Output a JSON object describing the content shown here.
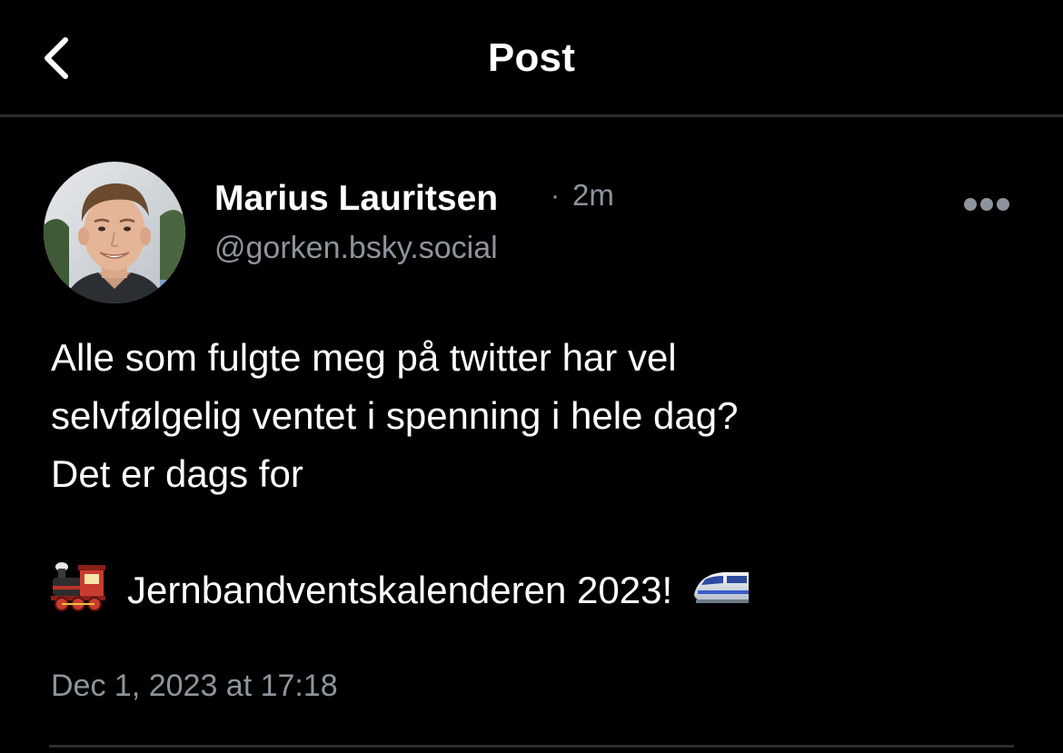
{
  "header": {
    "title": "Post",
    "back_icon": "chevron-left-icon"
  },
  "post": {
    "author_name": "Marius Lauritsen",
    "separator": "·",
    "age": "2m",
    "handle": "@gorken.bsky.social",
    "more_icon": "ellipsis-horizontal-icon",
    "text_lines": [
      "Alle som fulgte meg på twitter har vel",
      "selvfølgelig ventet i spenning i hele dag?",
      "Det er dags for"
    ],
    "campaign_text": "Jernbandventskalenderen 2023!",
    "leading_emoji": "steam-locomotive-icon",
    "trailing_emoji": "high-speed-train-icon",
    "timestamp": "Dec 1, 2023 at 17:18"
  },
  "colors": {
    "background": "#000000",
    "text_primary": "#ffffff",
    "text_secondary": "#8e949c",
    "divider": "#2a2d31"
  }
}
